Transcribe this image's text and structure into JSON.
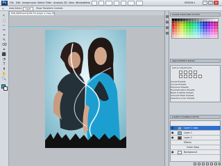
{
  "app": {
    "logo": "Ps",
    "menu": [
      "File",
      "Edit",
      "Image",
      "Layer",
      "Select",
      "Filter",
      "Analysis",
      "3D",
      "View",
      "Window",
      "Help"
    ],
    "workspace": "DESIGN ▾",
    "window_buttons": [
      "–",
      "□",
      "×"
    ]
  },
  "options_bar": {
    "tool_hint": "↖",
    "auto_select_label": "Auto-Select:",
    "auto_select_value": "Layer",
    "transform_label": "Show Transform Controls"
  },
  "document": {
    "tab_label": "PSD_8958 psd @ 66.7% (Layer 1 copy, RGB/8) ×"
  },
  "tools": [
    "↖",
    "⬚",
    "⌐",
    "✂",
    "⌖",
    "✎",
    "⌫",
    "✦",
    "⬛",
    "◔",
    "T",
    "⬆",
    "✋",
    "🔍"
  ],
  "colors": {
    "foreground": "#24a9d9",
    "background": "#ffffff",
    "accent": "#2f6fce"
  },
  "panels": {
    "swatch_tab": "COLOR   SWATCHES   STYLES",
    "adjustments_tab": "ADJUSTMENTS   MASKS",
    "add_adjustment": "Add an adjustment",
    "presets": [
      "Levels Presets",
      "Curves Presets",
      "Exposure Presets",
      "Hue/Saturation Presets",
      "Black & White Presets",
      "Channel Mixer Presets",
      "Selective Color Presets"
    ],
    "layers_tab": "LAYERS   CHANNELS   PATHS",
    "layers": [
      {
        "name": "Layer 1 copy",
        "selected": true
      },
      {
        "name": "Layer 1",
        "selected": false
      },
      {
        "name": "Layer 2",
        "selected": false
      },
      {
        "name": "Effects",
        "selected": false
      },
      {
        "name": "Outer Glow",
        "selected": false
      },
      {
        "name": "Background",
        "selected": false
      }
    ]
  }
}
